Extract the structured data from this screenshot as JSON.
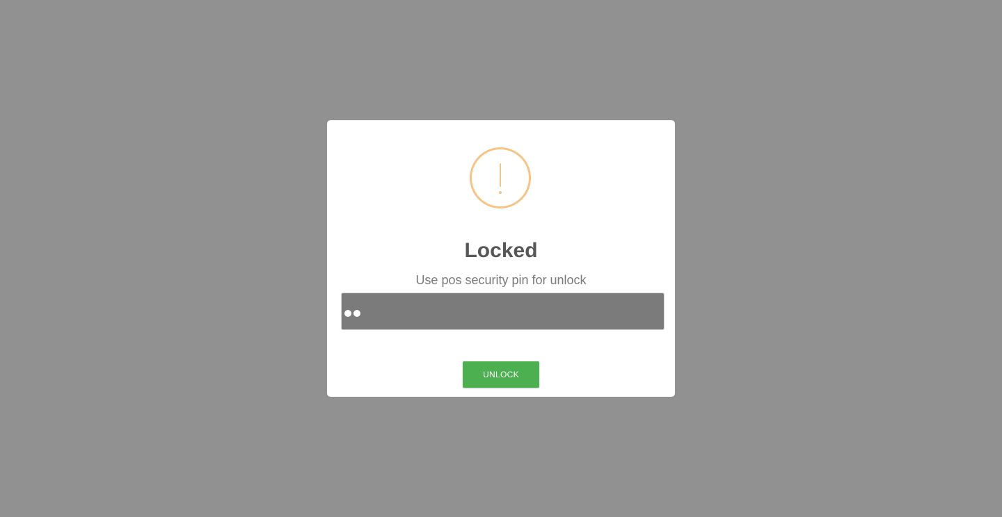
{
  "dialog": {
    "icon": "warning-exclamation-icon",
    "title": "Locked",
    "message": "Use pos security pin for unlock",
    "pin_masked_length": 2,
    "unlock_label": "UNLOCK"
  },
  "colors": {
    "backdrop": "#919191",
    "warning_accent": "#f8c486",
    "unlock_button": "#4caf50",
    "input_background": "#7b7b7b"
  }
}
